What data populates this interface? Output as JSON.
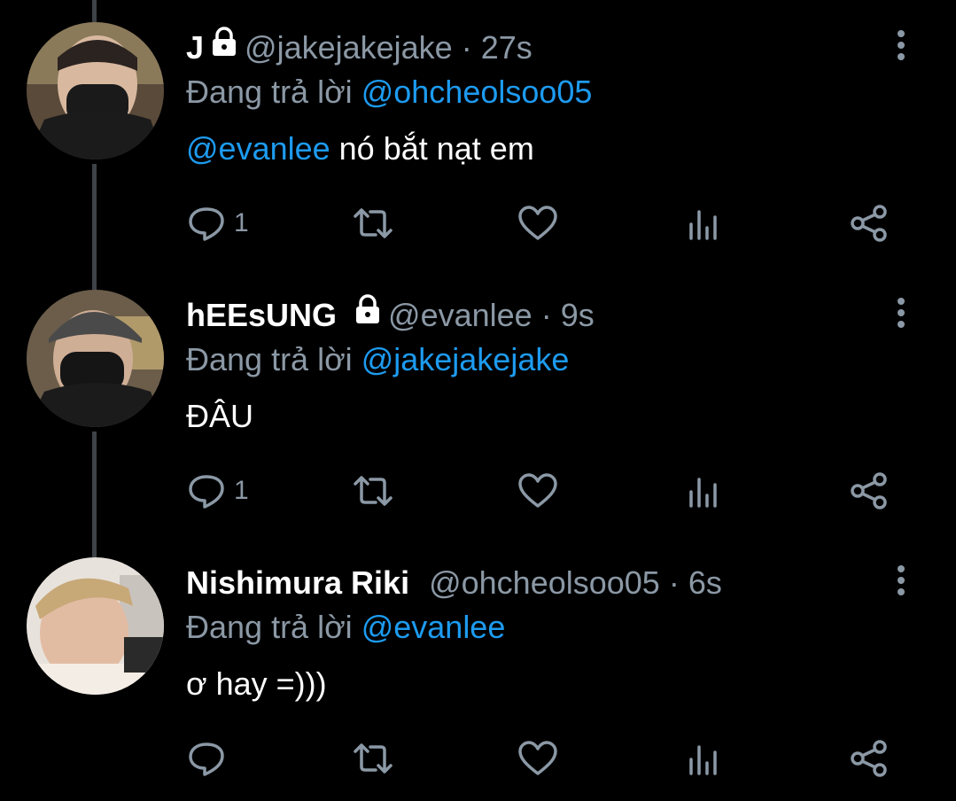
{
  "tweets": [
    {
      "name": "J",
      "locked": true,
      "handle": "@jakejakejake",
      "time": "· 27s",
      "reply_prefix": "Đang trả lời",
      "reply_to": "@ohcheolsoo05",
      "body_mention": "@evanlee",
      "body_text": " nó bắt nạt em",
      "reply_count": "1"
    },
    {
      "name": "hEEsUNG",
      "locked": true,
      "handle": "@evanlee",
      "time": "· 9s",
      "reply_prefix": "Đang trả lời",
      "reply_to": "@jakejakejake",
      "body_mention": "",
      "body_text": "ĐÂU",
      "reply_count": "1"
    },
    {
      "name": "Nishimura Riki",
      "locked": false,
      "handle": "@ohcheolsoo05",
      "time": "· 6s",
      "reply_prefix": "Đang trả lời",
      "reply_to": "@evanlee",
      "body_mention": "",
      "body_text": "ơ hay =)))",
      "reply_count": ""
    }
  ],
  "icons": [
    "lock-icon",
    "more-icon",
    "reply-icon",
    "retweet-icon",
    "like-icon",
    "stats-icon",
    "share-icon"
  ],
  "colors": {
    "background": "#000000",
    "text": "#ffffff",
    "secondary": "#8b98a5",
    "mention": "#1d9bf0",
    "thread_line": "#3d4247"
  }
}
